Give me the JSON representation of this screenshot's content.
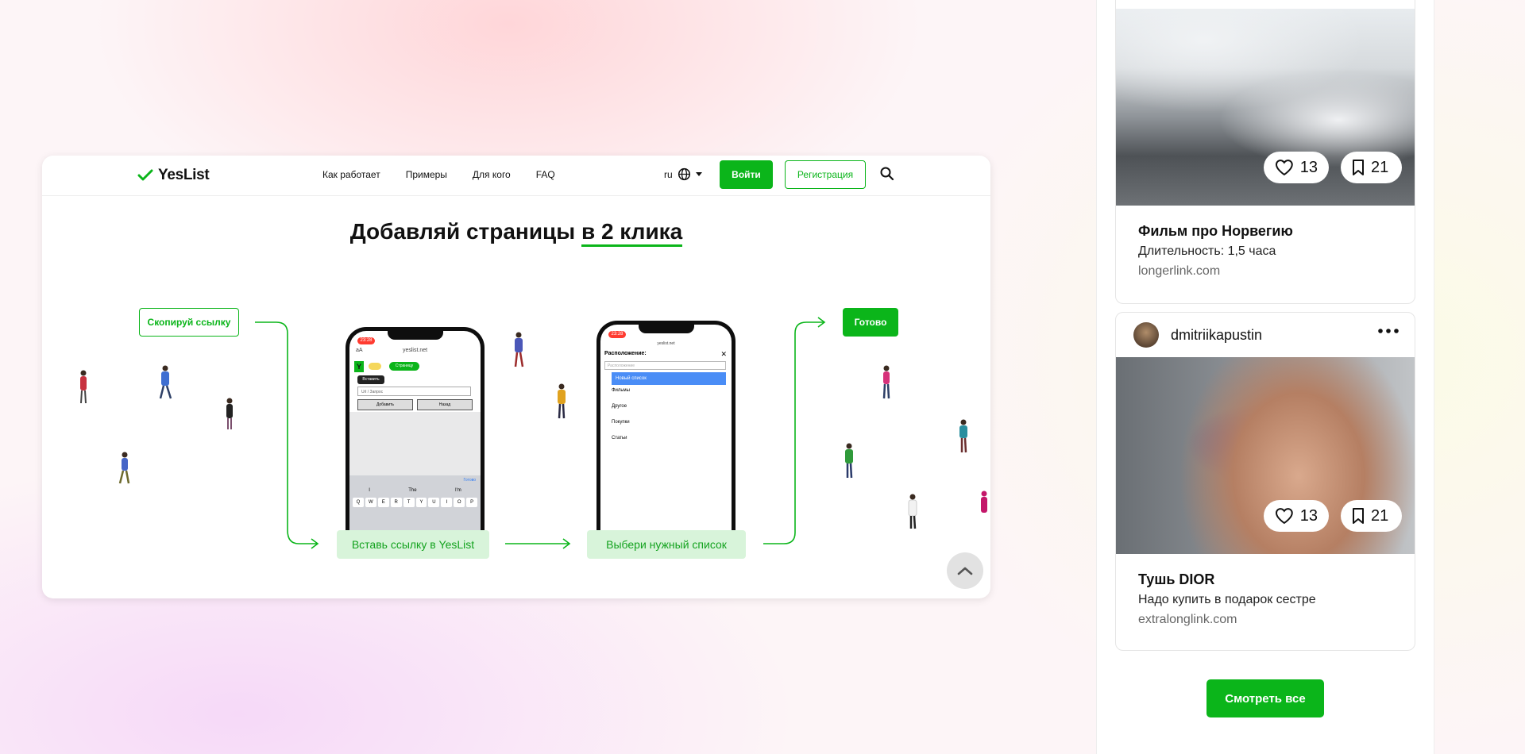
{
  "site": {
    "logo_text": "YesList",
    "nav": [
      "Как работает",
      "Примеры",
      "Для кого",
      "FAQ"
    ],
    "lang": "ru",
    "login_label": "Войти",
    "register_label": "Регистрация",
    "hero_title_start": "Добавляй страницы ",
    "hero_title_accent": "в 2 клика",
    "steps": {
      "copy": "Скопируй ссылку",
      "paste": "Вставь ссылку в YesList",
      "choose": "Выбери нужный список",
      "done": "Готово"
    },
    "phone1": {
      "time": "23:28",
      "url": "yeslist.net",
      "top_left": "аА",
      "toggle_label": "Страницу",
      "paste_tooltip": "Вставить",
      "input_placeholder": "Url / Запрос",
      "add_label": "Добавить",
      "back_label": "Назад",
      "done_label": "Готово",
      "suggestions": [
        "I",
        "The",
        "I'm"
      ],
      "keys": [
        "Q",
        "W",
        "E",
        "R",
        "T",
        "Y",
        "U",
        "I",
        "O",
        "P"
      ]
    },
    "phone2": {
      "time": "23:28",
      "url": "yeslist.net",
      "header": "Расположение:",
      "search_placeholder": "Расположение",
      "new_list": "Новый список",
      "items": [
        "Фильмы",
        "Другое",
        "Покупки",
        "Статьи"
      ]
    }
  },
  "feed": {
    "posts": [
      {
        "likes": "13",
        "saves": "21",
        "title": "Фильм про Норвегию",
        "description": "Длительность: 1,5 часа",
        "link": "longerlink.com"
      },
      {
        "username": "dmitriikapustin",
        "likes": "13",
        "saves": "21",
        "title": "Тушь DIOR",
        "description": "Надо купить в подарок сестре",
        "link": "extralonglink.com"
      }
    ],
    "view_all_label": "Смотреть все"
  },
  "colors": {
    "accent": "#0bb51a",
    "accent_light": "#d8f4da"
  }
}
